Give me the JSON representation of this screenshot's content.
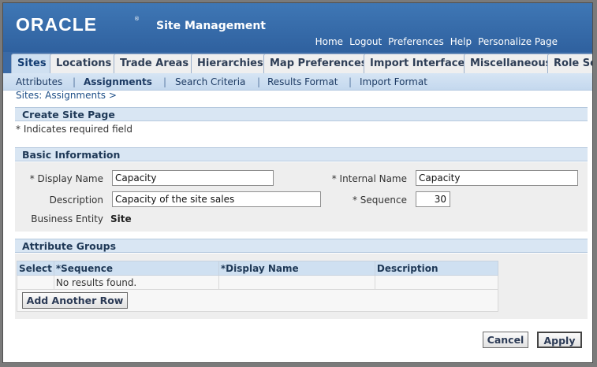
{
  "header": {
    "logo": "ORACLE",
    "logo_mark": "®",
    "app_title": "Site Management",
    "global_links": [
      "Home",
      "Logout",
      "Preferences",
      "Help",
      "Personalize Page"
    ]
  },
  "tabs": [
    "Sites",
    "Locations",
    "Trade Areas",
    "Hierarchies",
    "Map Preferences",
    "Import Interface",
    "Miscellaneous",
    "Role Se"
  ],
  "subtabs": [
    "Attributes",
    "Assignments",
    "Search Criteria",
    "Results Format",
    "Import Format"
  ],
  "breadcrumb": "Sites: Assignments  >",
  "create_section": {
    "title": "Create Site Page",
    "required_note": "* Indicates required field"
  },
  "basic_info": {
    "title": "Basic Information",
    "display_name_label": "* Display Name",
    "display_name_value": "Capacity",
    "internal_name_label": "* Internal Name",
    "internal_name_value": "Capacity",
    "description_label": "Description",
    "description_value": "Capacity of the site sales",
    "sequence_label": "* Sequence",
    "sequence_value": "30",
    "business_entity_label": "Business Entity",
    "business_entity_value": "Site"
  },
  "attribute_groups": {
    "title": "Attribute Groups",
    "columns": [
      "Select",
      "*Sequence",
      "*Display Name",
      "Description"
    ],
    "empty_message": "No results found.",
    "add_row_label": "Add Another Row"
  },
  "actions": {
    "cancel_label": "Cancel",
    "apply_label": "Apply"
  },
  "colors": {
    "banner": "#3a6aa6",
    "subtab_bg": "#cfe0f1",
    "section_header": "#d9e6f3"
  }
}
